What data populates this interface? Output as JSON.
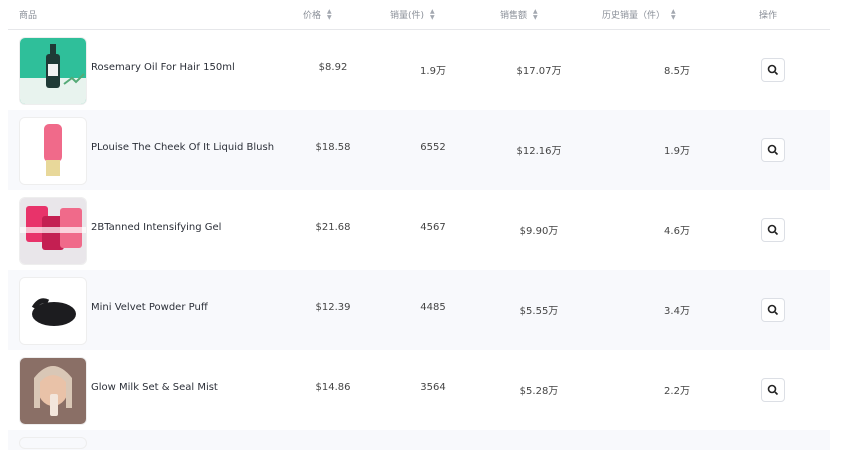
{
  "header": {
    "product": "商品",
    "price": "价格",
    "sales": "销量(件)",
    "revenue": "销售额",
    "history_sales": "历史销量（件）",
    "action": "操作"
  },
  "rows": [
    {
      "name": "Rosemary Oil For Hair 150ml",
      "price": "$8.92",
      "sales": "1.9万",
      "revenue": "$17.07万",
      "history": "8.5万"
    },
    {
      "name": "PLouise The Cheek Of It Liquid Blush",
      "price": "$18.58",
      "sales": "6552",
      "revenue": "$12.16万",
      "history": "1.9万"
    },
    {
      "name": "2BTanned Intensifying Gel",
      "price": "$21.68",
      "sales": "4567",
      "revenue": "$9.90万",
      "history": "4.6万"
    },
    {
      "name": "Mini Velvet Powder Puff",
      "price": "$12.39",
      "sales": "4485",
      "revenue": "$5.55万",
      "history": "3.4万"
    },
    {
      "name": "Glow Milk Set & Seal Mist",
      "price": "$14.86",
      "sales": "3564",
      "revenue": "$5.28万",
      "history": "2.2万"
    }
  ],
  "icons": {
    "sort": "sort-icon",
    "search": "search-icon"
  },
  "colors": {
    "alt_row": "#f8f9fc",
    "header_text": "#8a8f98",
    "border": "#e6e7ea"
  }
}
